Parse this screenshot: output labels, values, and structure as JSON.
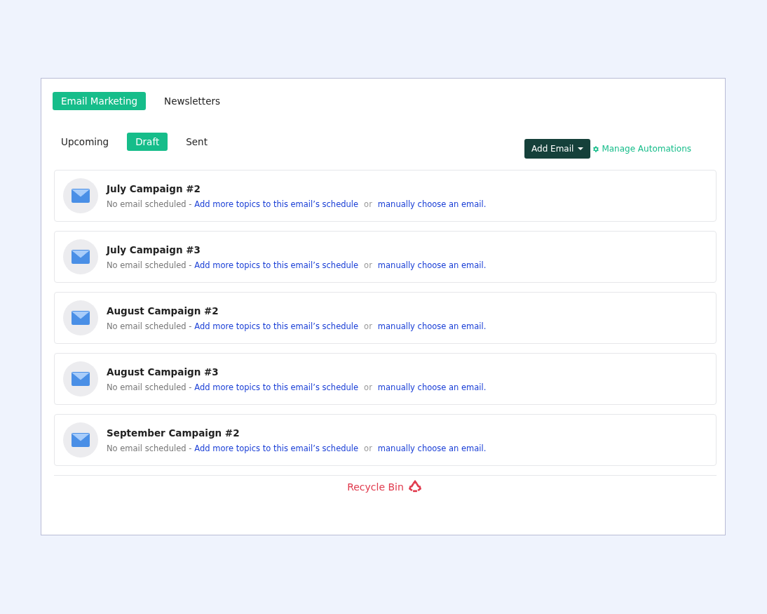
{
  "main_tabs": [
    {
      "label": "Email Marketing",
      "selected": true
    },
    {
      "label": "Newsletters",
      "selected": false
    }
  ],
  "sub_tabs": [
    {
      "label": "Upcoming",
      "selected": false
    },
    {
      "label": "Draft",
      "selected": true
    },
    {
      "label": "Sent",
      "selected": false
    }
  ],
  "add_email_button": "Add Email",
  "manage_link": "Manage Automations",
  "emails": [
    {
      "title": "July Campaign #2",
      "status": "No email scheduled -",
      "add_link": "Add more topics to this email’s schedule",
      "or": "or",
      "choose_link": "manually choose an email."
    },
    {
      "title": "July Campaign #3",
      "status": "No email scheduled -",
      "add_link": "Add more topics to this email’s schedule",
      "or": "or",
      "choose_link": "manually choose an email."
    },
    {
      "title": "August Campaign #2",
      "status": "No email scheduled -",
      "add_link": "Add more topics to this email’s schedule",
      "or": "or",
      "choose_link": "manually choose an email."
    },
    {
      "title": "August Campaign #3",
      "status": "No email scheduled -",
      "add_link": "Add more topics to this email’s schedule",
      "or": "or",
      "choose_link": "manually choose an email."
    },
    {
      "title": "September Campaign #2",
      "status": "No email scheduled -",
      "add_link": "Add more topics to this email’s schedule",
      "or": "or",
      "choose_link": "manually choose an email."
    }
  ],
  "recycle_bin": "Recycle Bin"
}
